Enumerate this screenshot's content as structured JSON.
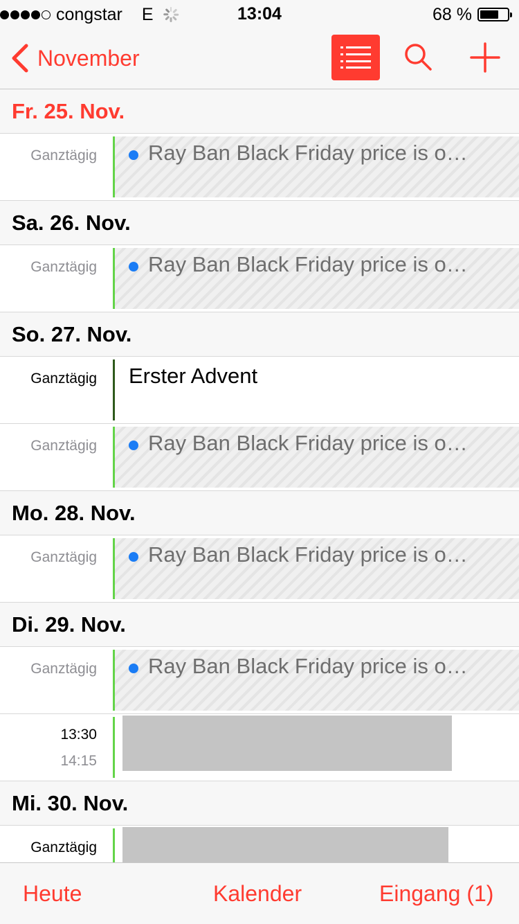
{
  "statusbar": {
    "carrier": "congstar",
    "network": "E",
    "time": "13:04",
    "battery": "68 %",
    "battery_level": 0.68,
    "signal_bars": 4
  },
  "nav": {
    "back_label": "November",
    "accent": "#ff3b30"
  },
  "days": [
    {
      "header": "Fr. 25. Nov.",
      "today": true,
      "events": [
        {
          "time": "Ganztägig",
          "title": "Ray Ban Black Friday price is o…",
          "kind": "hatched"
        }
      ]
    },
    {
      "header": "Sa. 26. Nov.",
      "events": [
        {
          "time": "Ganztägig",
          "title": "Ray Ban Black Friday price is o…",
          "kind": "hatched"
        }
      ]
    },
    {
      "header": "So. 27. Nov.",
      "events": [
        {
          "time": "Ganztägig",
          "title": "Erster Advent",
          "kind": "plain"
        },
        {
          "time": "Ganztägig",
          "title": "Ray Ban Black Friday price is o…",
          "kind": "hatched"
        }
      ]
    },
    {
      "header": "Mo. 28. Nov.",
      "events": [
        {
          "time": "Ganztägig",
          "title": "Ray Ban Black Friday price is o…",
          "kind": "hatched"
        }
      ]
    },
    {
      "header": "Di. 29. Nov.",
      "events": [
        {
          "time": "Ganztägig",
          "title": "Ray Ban Black Friday price is o…",
          "kind": "hatched"
        },
        {
          "start": "13:30",
          "end": "14:15",
          "kind": "redacted"
        }
      ]
    },
    {
      "header": "Mi. 30. Nov.",
      "events": [
        {
          "time": "Ganztägig",
          "kind": "redacted"
        }
      ]
    }
  ],
  "tabbar": {
    "today": "Heute",
    "calendars": "Kalender",
    "inbox": "Eingang (1)"
  }
}
